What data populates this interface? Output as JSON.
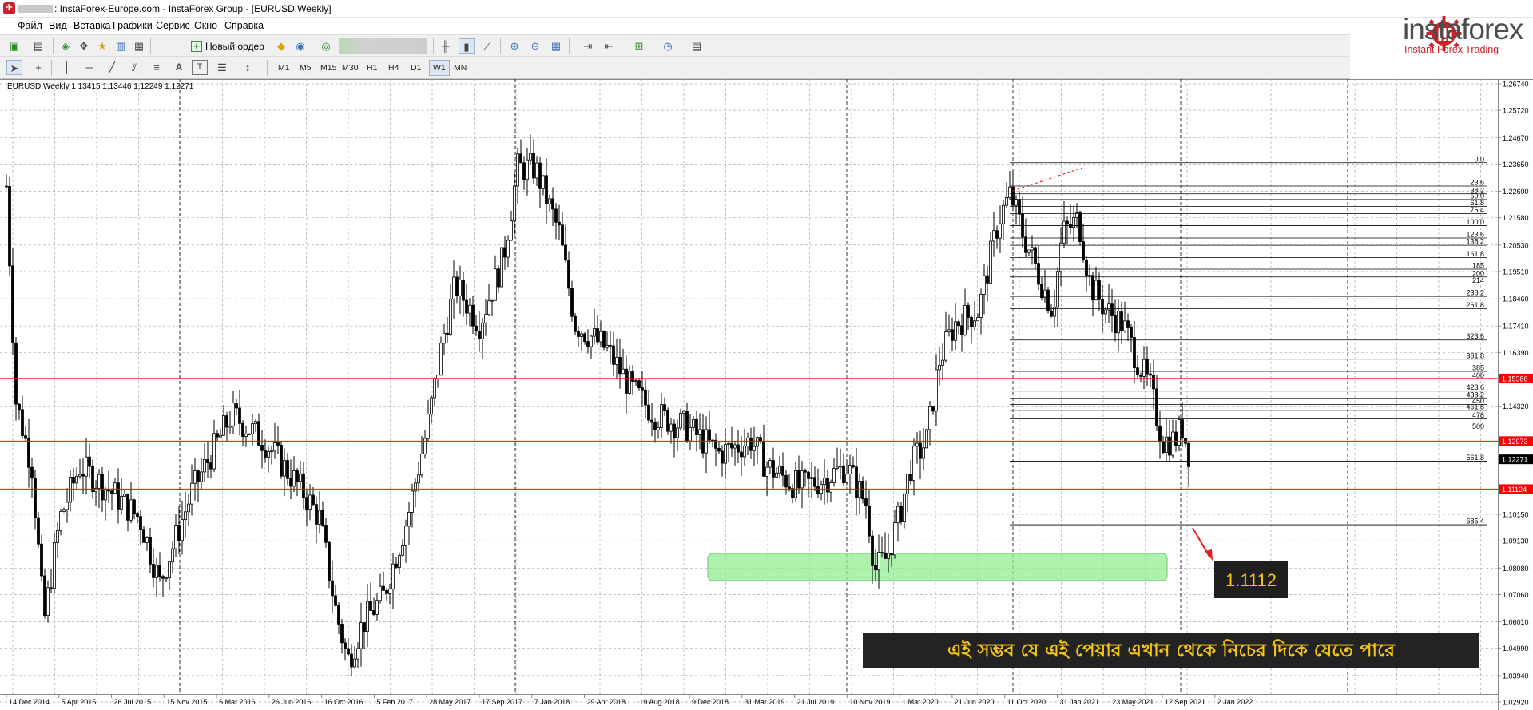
{
  "window": {
    "title": ": InstaForex-Europe.com - InstaForex Group - [EURUSD,Weekly]"
  },
  "menu": [
    "Файл",
    "Вид",
    "Вставка",
    "Графики",
    "Сервис",
    "Окно",
    "Справка"
  ],
  "toolbar": {
    "new_order_label": "Новый ордер",
    "timeframes": [
      "M1",
      "M5",
      "M15",
      "M30",
      "H1",
      "H4",
      "D1",
      "W1",
      "MN"
    ],
    "active_timeframe": "W1"
  },
  "logo": {
    "name": "instaforex",
    "tagline": "Instant Forex Trading",
    "brand_color": "#c9202a"
  },
  "chart": {
    "symbol_info": "EURUSD,Weekly  1.13415 1.13446 1.12249 1.12271",
    "price_labels": [
      "1.26740",
      "1.25720",
      "1.24670",
      "1.23650",
      "1.22600",
      "1.21580",
      "1.20530",
      "1.19510",
      "1.18460",
      "1.17410",
      "1.16390",
      "1.15386",
      "1.14320",
      "1.12973",
      "1.12271",
      "1.11124",
      "1.10150",
      "1.09130",
      "1.08080",
      "1.07060",
      "1.06010",
      "1.04990",
      "1.03940",
      "1.02920"
    ],
    "date_labels": [
      "14 Dec 2014",
      "5 Apr 2015",
      "26 Jul 2015",
      "15 Nov 2015",
      "6 Mar 2016",
      "26 Jun 2016",
      "16 Oct 2016",
      "5 Feb 2017",
      "28 May 2017",
      "17 Sep 2017",
      "7 Jan 2018",
      "29 Apr 2018",
      "19 Aug 2018",
      "9 Dec 2018",
      "31 Mar 2019",
      "21 Jul 2019",
      "10 Nov 2019",
      "1 Mar 2020",
      "21 Jun 2020",
      "11 Oct 2020",
      "31 Jan 2021",
      "23 May 2021",
      "12 Sep 2021",
      "2 Jan 2022"
    ],
    "fib_levels": [
      "0.0",
      "23.6",
      "38.2",
      "50.0",
      "61.8",
      "76.4",
      "100.0",
      "123.6",
      "138.2",
      "161.8",
      "185",
      "200",
      "214",
      "238.2",
      "261.8",
      "323.6",
      "361.8",
      "385",
      "400",
      "423.6",
      "438.2",
      "450",
      "461.8",
      "478",
      "500",
      "561.8",
      "685.4"
    ],
    "horizontal_lines": [
      {
        "label": "1.15386",
        "color": "#ff0000"
      },
      {
        "label": "1.12973",
        "color": "#ff0000"
      },
      {
        "label": "1.11124",
        "color": "#ff0000"
      }
    ],
    "current_price": "1.12271",
    "annotation_target": "1.1112",
    "annotation_text": "এই সম্ভব যে এই পেয়ার এখান থেকে নিচের দিকে যেতে পারে",
    "annotation_text_color": "#f5c518",
    "support_zone_color": "#90ee90"
  }
}
